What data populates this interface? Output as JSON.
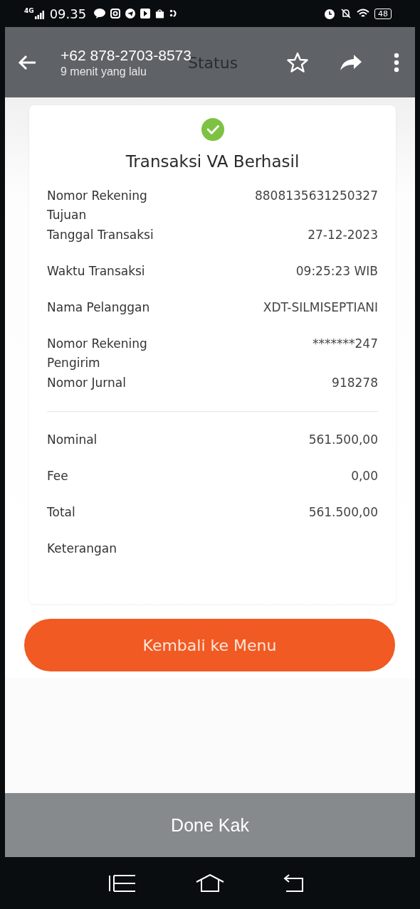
{
  "status_bar": {
    "network": "4G",
    "time": "09.35",
    "battery": "48"
  },
  "viewer": {
    "sender": "+62 878-2703-8573",
    "time_ago": "9 menit yang lalu",
    "caption": "Done Kak"
  },
  "screen": {
    "title": "Status",
    "heading": "Transaksi VA Berhasil",
    "rows": [
      {
        "kind": "field",
        "label": "Nomor Rekening Tujuan",
        "value": "8808135631250327"
      },
      {
        "kind": "field",
        "label": "Tanggal Transaksi",
        "value": "27-12-2023"
      },
      {
        "kind": "field",
        "label": "Waktu Transaksi",
        "value": "09:25:23 WIB"
      },
      {
        "kind": "field",
        "label": "Nama Pelanggan",
        "value": "XDT-SILMISEPTIANI"
      },
      {
        "kind": "field",
        "label": "Nomor Rekening Pengirim",
        "value": "*******247"
      },
      {
        "kind": "field",
        "label": "Nomor Jurnal",
        "value": "918278"
      },
      {
        "kind": "divider"
      },
      {
        "kind": "field",
        "label": "Nominal",
        "value": "561.500,00"
      },
      {
        "kind": "field",
        "label": "Fee",
        "value": "0,00"
      },
      {
        "kind": "field",
        "label": "Total",
        "value": "561.500,00"
      },
      {
        "kind": "field",
        "label": "Keterangan"
      }
    ],
    "button": "Kembali ke Menu"
  }
}
